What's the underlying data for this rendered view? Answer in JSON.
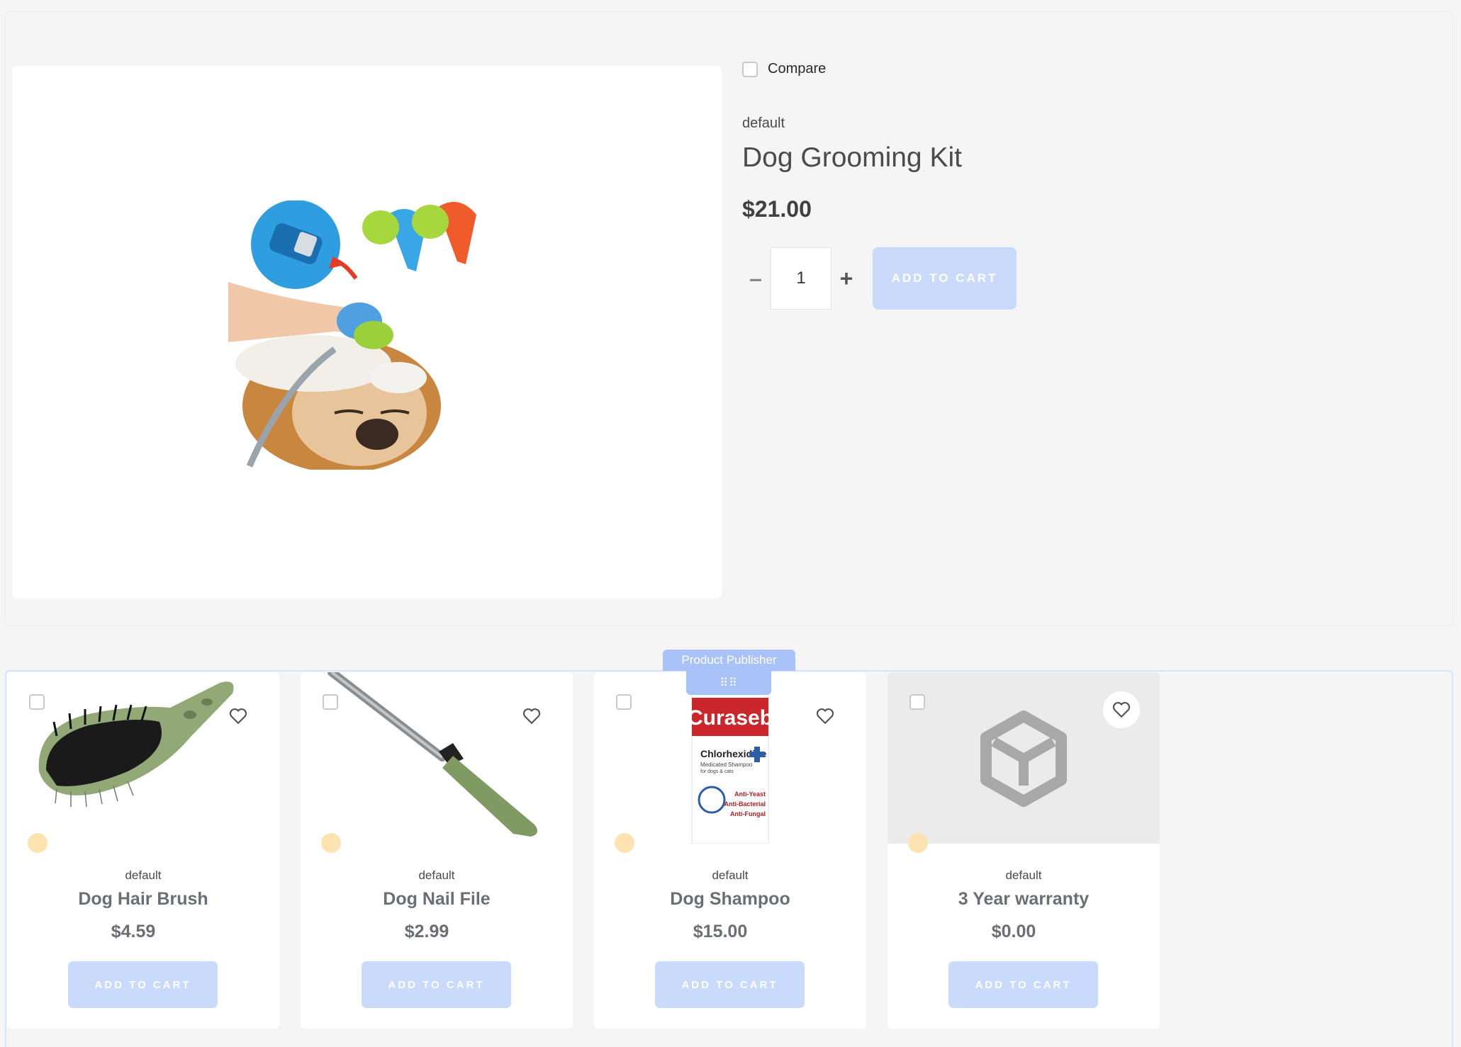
{
  "product": {
    "compare_label": "Compare",
    "vendor": "default",
    "title": "Dog Grooming Kit",
    "price": "$21.00",
    "quantity": "1",
    "qty_minus": "–",
    "qty_plus": "+",
    "add_to_cart": "ADD TO CART"
  },
  "publisher": {
    "tag": "Product Publisher",
    "handle_glyph": "⠿⠿",
    "cards": [
      {
        "vendor": "default",
        "title": "Dog Hair Brush",
        "price": "$4.59",
        "add_to_cart": "ADD TO CART"
      },
      {
        "vendor": "default",
        "title": "Dog Nail File",
        "price": "$2.99",
        "add_to_cart": "ADD TO CART"
      },
      {
        "vendor": "default",
        "title": "Dog Shampoo",
        "price": "$15.00",
        "add_to_cart": "ADD TO CART",
        "image_text": {
          "brand": "Curaseb",
          "line1": "Chlorhexidine",
          "line2": "Medicated Shampoo",
          "line3": "for dogs & cats",
          "line4": "Anti-Yeast",
          "line5": "Anti-Bacterial",
          "line6": "Anti-Fungal"
        }
      },
      {
        "vendor": "default",
        "title": "3 Year warranty",
        "price": "$0.00",
        "add_to_cart": "ADD TO CART"
      }
    ]
  },
  "colors": {
    "accent_button": "#c9dafd",
    "publisher_accent": "#a9c2f7",
    "variant_dot": "#fde3b0"
  }
}
